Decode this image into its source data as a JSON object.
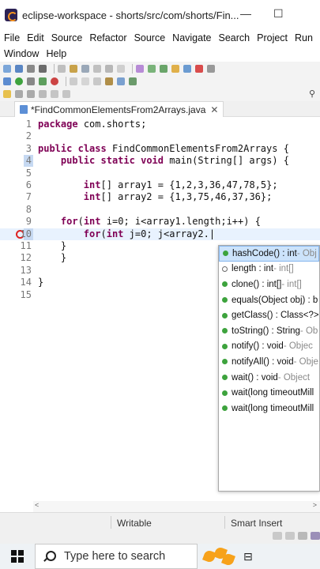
{
  "window": {
    "title": "eclipse-workspace - shorts/src/com/shorts/Fin...",
    "minimize": "—",
    "maximize": "☐"
  },
  "menu": {
    "row1": [
      "File",
      "Edit",
      "Source",
      "Refactor",
      "Source",
      "Navigate",
      "Search",
      "Project",
      "Run"
    ],
    "row2": [
      "Window",
      "Help"
    ]
  },
  "editor": {
    "tab_label": "*FindCommonElementsFrom2Arrays.java",
    "tab_close": "✕",
    "lines": [
      {
        "n": "1",
        "code": "package com.shorts;"
      },
      {
        "n": "2",
        "code": ""
      },
      {
        "n": "3",
        "code": "public class FindCommonElementsFrom2Arrays {"
      },
      {
        "n": "4",
        "code": "    public static void main(String[] args) {"
      },
      {
        "n": "5",
        "code": ""
      },
      {
        "n": "6",
        "code": "        int[] array1 = {1,2,3,36,47,78,5};"
      },
      {
        "n": "7",
        "code": "        int[] array2 = {1,3,75,46,37,36};"
      },
      {
        "n": "8",
        "code": ""
      },
      {
        "n": "9",
        "code": "    for(int i=0; i<array1.length;i++) {"
      },
      {
        "n": "10",
        "code": "        for(int j=0; j<array2.|"
      },
      {
        "n": "11",
        "code": "    }"
      },
      {
        "n": "12",
        "code": "    }"
      },
      {
        "n": "13",
        "code": ""
      },
      {
        "n": "14",
        "code": "}"
      },
      {
        "n": "15",
        "code": ""
      }
    ]
  },
  "completion": {
    "items": [
      {
        "sig": "hashCode() : int",
        "owner": " - Obj",
        "kind": "green"
      },
      {
        "sig": "length : int",
        "owner": " - int[]",
        "kind": "hollow"
      },
      {
        "sig": "clone() : int[]",
        "owner": " - int[]",
        "kind": "green"
      },
      {
        "sig": "equals(Object obj) : b",
        "owner": "",
        "kind": "green"
      },
      {
        "sig": "getClass() : Class<?>",
        "owner": "",
        "kind": "green"
      },
      {
        "sig": "toString() : String",
        "owner": " - Ob",
        "kind": "green"
      },
      {
        "sig": "notify() : void",
        "owner": " - Objec",
        "kind": "green"
      },
      {
        "sig": "notifyAll() : void",
        "owner": " - Obje",
        "kind": "green"
      },
      {
        "sig": "wait() : void",
        "owner": " - Object",
        "kind": "green"
      },
      {
        "sig": "wait(long timeoutMill",
        "owner": "",
        "kind": "green"
      },
      {
        "sig": "wait(long timeoutMill",
        "owner": "",
        "kind": "green"
      }
    ]
  },
  "status": {
    "writable": "Writable",
    "insert": "Smart Insert"
  },
  "taskbar": {
    "search_placeholder": "Type here to search"
  }
}
